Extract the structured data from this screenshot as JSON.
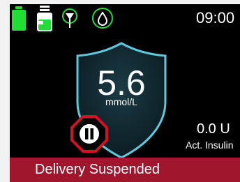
{
  "status_bar": {
    "time": "09:00",
    "icons": [
      "battery-icon",
      "insulin-cartridge-icon",
      "connection-antenna-icon",
      "cgm-sensor-icon"
    ],
    "accent_color": "#22dd33"
  },
  "glucose": {
    "value": "5.6",
    "unit": "mmol/L"
  },
  "insulin": {
    "value": "0.0 U",
    "label": "Act. Insulin"
  },
  "controls": {
    "pause_icon": "pause-icon"
  },
  "banner": {
    "text": "Delivery Suspended",
    "color": "#a0162c"
  },
  "colors": {
    "shield_border": "#5ec9dc",
    "pause_ring": "#d31025"
  }
}
